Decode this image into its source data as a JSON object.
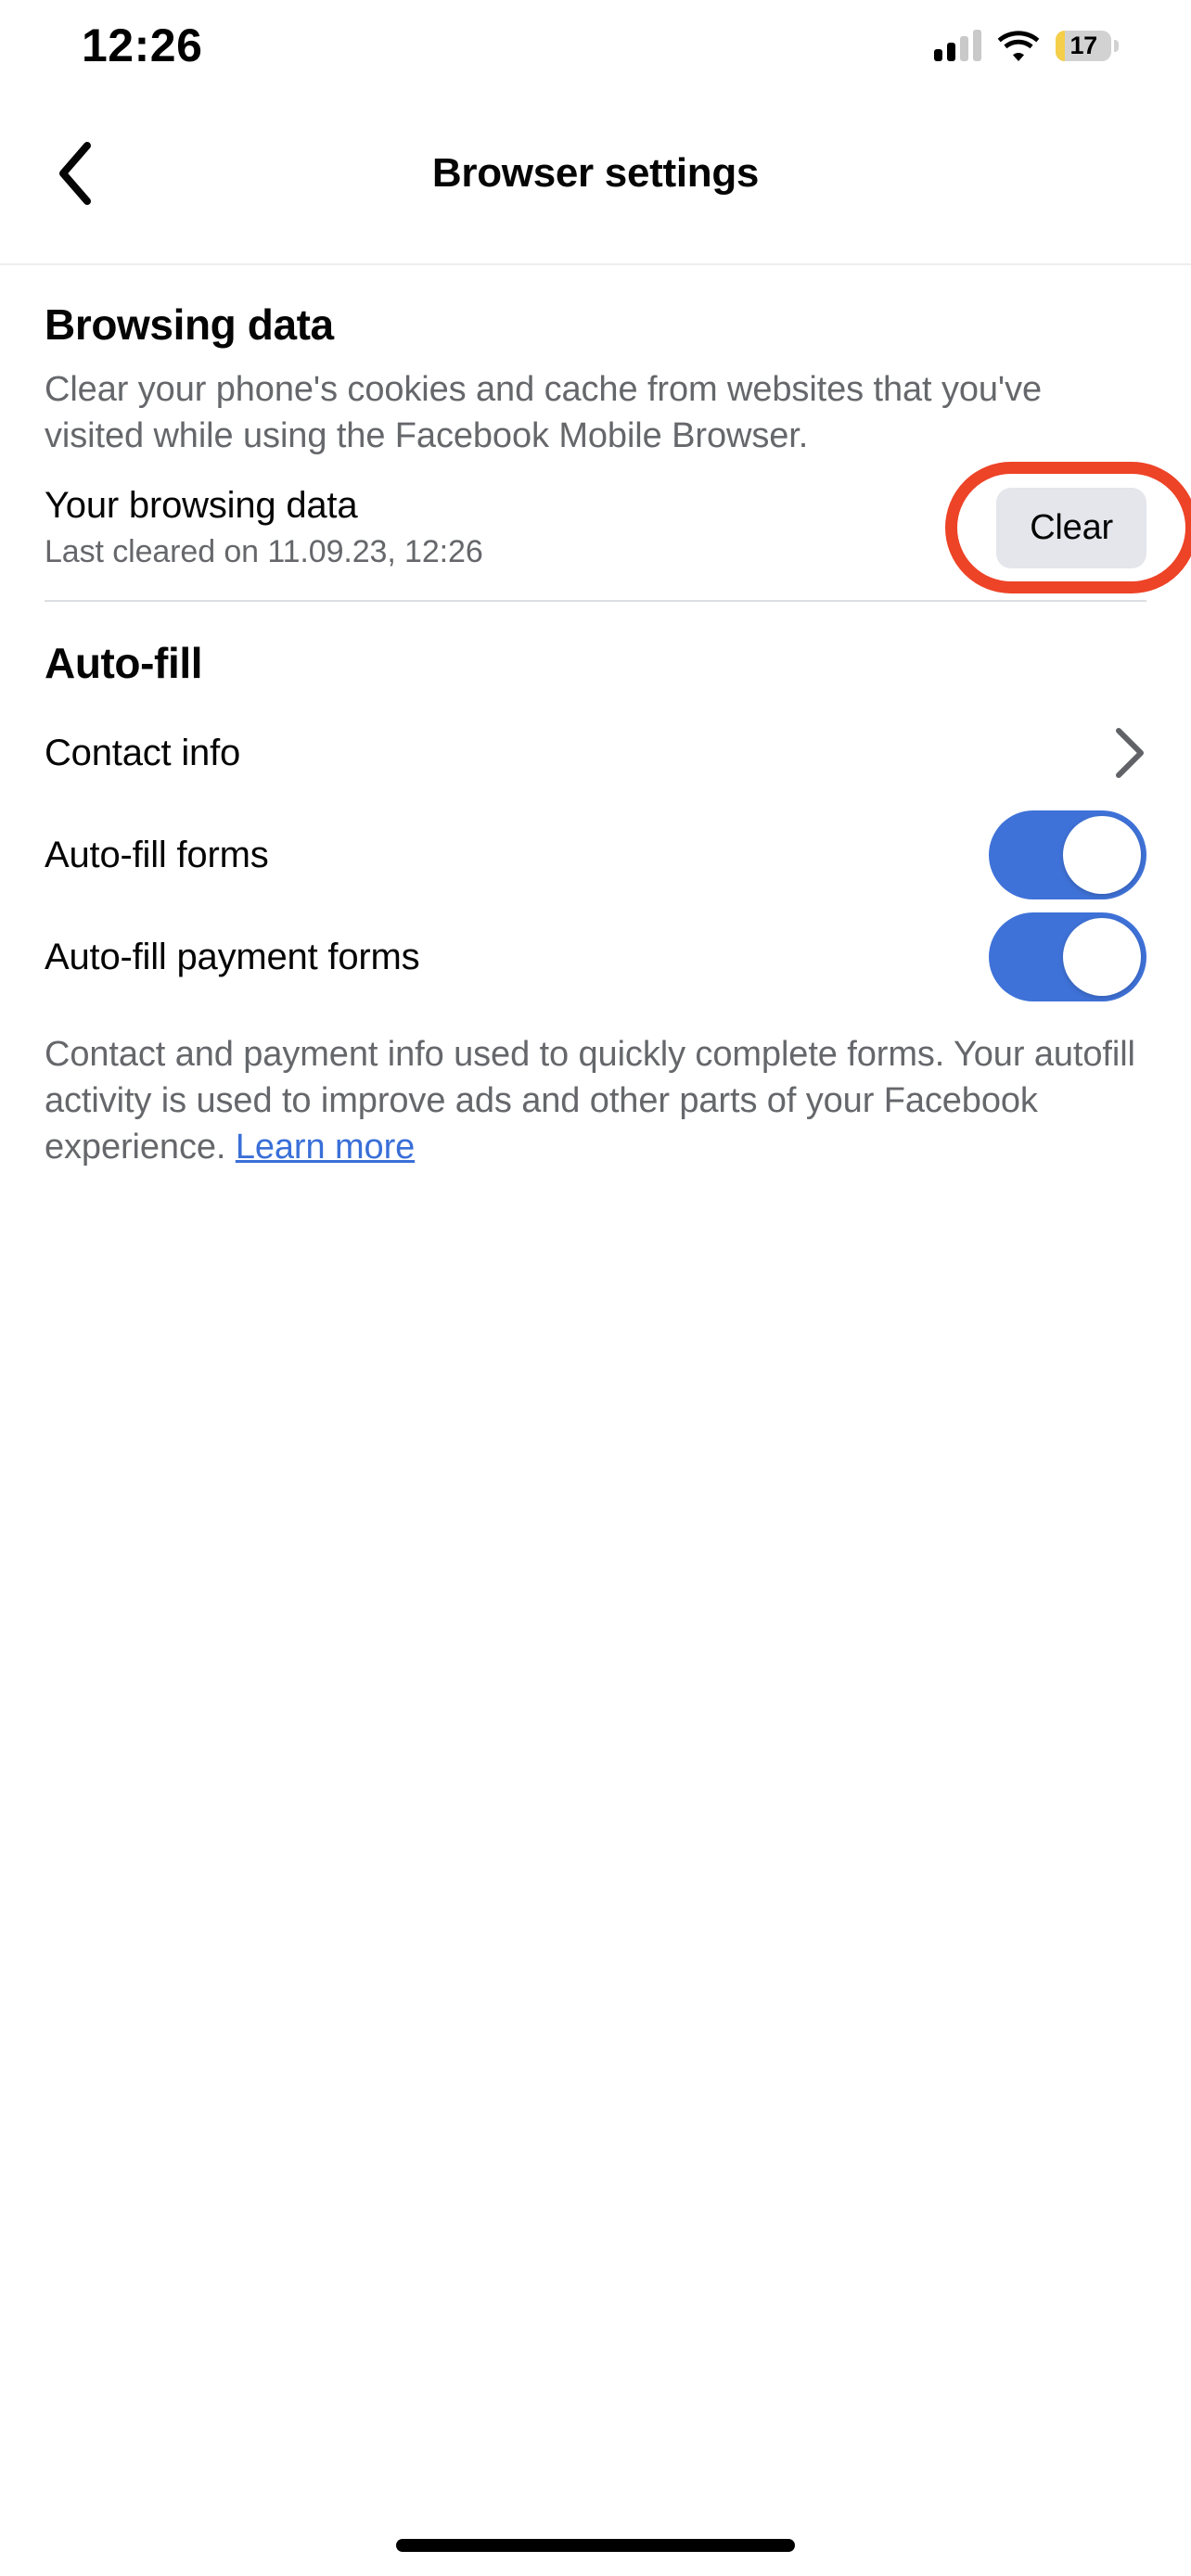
{
  "status_bar": {
    "time": "12:26",
    "signal_icon": "cellular-signal-icon",
    "signal_bars_active": 2,
    "signal_bars_total": 4,
    "wifi_icon": "wifi-icon",
    "battery_icon": "battery-icon",
    "battery_level": "17",
    "battery_percent": 17,
    "battery_low_power_color": "#f5cf4a"
  },
  "nav": {
    "back_icon": "chevron-left-icon",
    "title": "Browser settings"
  },
  "browsing_data": {
    "heading": "Browsing data",
    "description": "Clear your phone's cookies and cache from websites that you've visited while using the Facebook Mobile Browser.",
    "row_label": "Your browsing data",
    "row_sublabel": "Last cleared on 11.09.23, 12:26",
    "clear_button": "Clear",
    "annotation_color": "#ed4327"
  },
  "auto_fill": {
    "heading": "Auto-fill",
    "contact_info": {
      "label": "Contact info",
      "chevron_icon": "chevron-right-icon"
    },
    "toggles": [
      {
        "label": "Auto-fill forms",
        "state": "on"
      },
      {
        "label": "Auto-fill payment forms",
        "state": "on"
      }
    ],
    "footer_text": "Contact and payment info used to quickly complete forms. Your autofill activity is used to improve ads and other parts of your Facebook experience. ",
    "footer_link": "Learn more"
  },
  "colors": {
    "toggle_on": "#3f72d8",
    "link": "#3a6fd8",
    "button_bg": "#e4e6eb",
    "secondary_text": "#65676b"
  }
}
